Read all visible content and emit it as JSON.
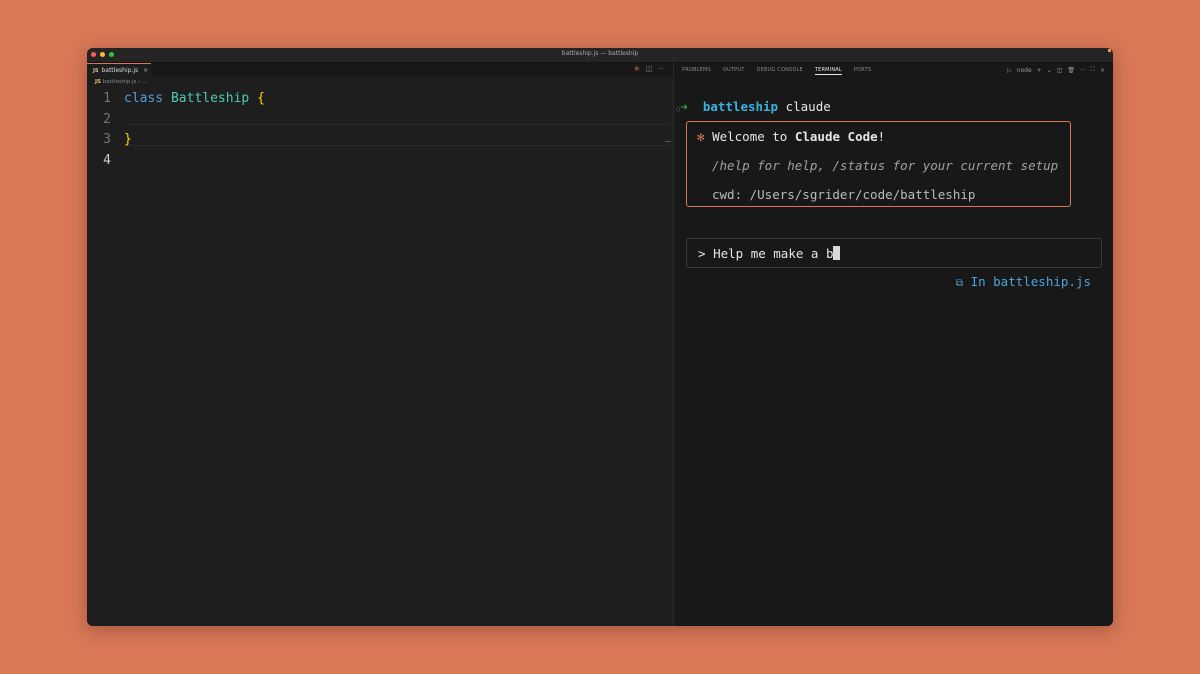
{
  "window": {
    "title": "battleship.js — battleship"
  },
  "editor": {
    "tab": {
      "lang": "JS",
      "filename": "battleship.js",
      "close": "×"
    },
    "tab_actions": {
      "claude": "✳",
      "split": "◫",
      "more": "···"
    },
    "breadcrumb": {
      "lang": "JS",
      "path": "battleship.js",
      "sep": "› ..."
    },
    "lines": [
      {
        "n": "1",
        "keyword": "class",
        "name": "Battleship",
        "brace": "{"
      },
      {
        "n": "2"
      },
      {
        "n": "3",
        "brace": "}"
      },
      {
        "n": "4"
      }
    ]
  },
  "panel": {
    "tabs": [
      "PROBLEMS",
      "OUTPUT",
      "DEBUG CONSOLE",
      "TERMINAL",
      "PORTS"
    ],
    "active_tab": "TERMINAL",
    "actions": {
      "shell_icon": "▷",
      "shell": "node",
      "add": "+",
      "dropdown": "⌄",
      "split": "◫",
      "trash": "🗑",
      "more": "···",
      "maximize": "⛶",
      "close": "×"
    }
  },
  "terminal": {
    "prompt": {
      "dot": "○",
      "arrow": "➜",
      "dir": "battleship",
      "cmd": "claude"
    },
    "welcome": {
      "icon": "✻",
      "prefix": "Welcome to ",
      "app": "Claude Code",
      "suffix": "!",
      "help": "/help for help, /status for your current setup",
      "cwd": "cwd: /Users/sgrider/code/battleship"
    },
    "input": {
      "prompt": ">",
      "text": "Help me make a b"
    },
    "context": {
      "icon": "⧉",
      "label": "In battleship.js"
    }
  },
  "colors": {
    "background": "#d97757",
    "accent": "#d97757",
    "link": "#4aa3df"
  }
}
